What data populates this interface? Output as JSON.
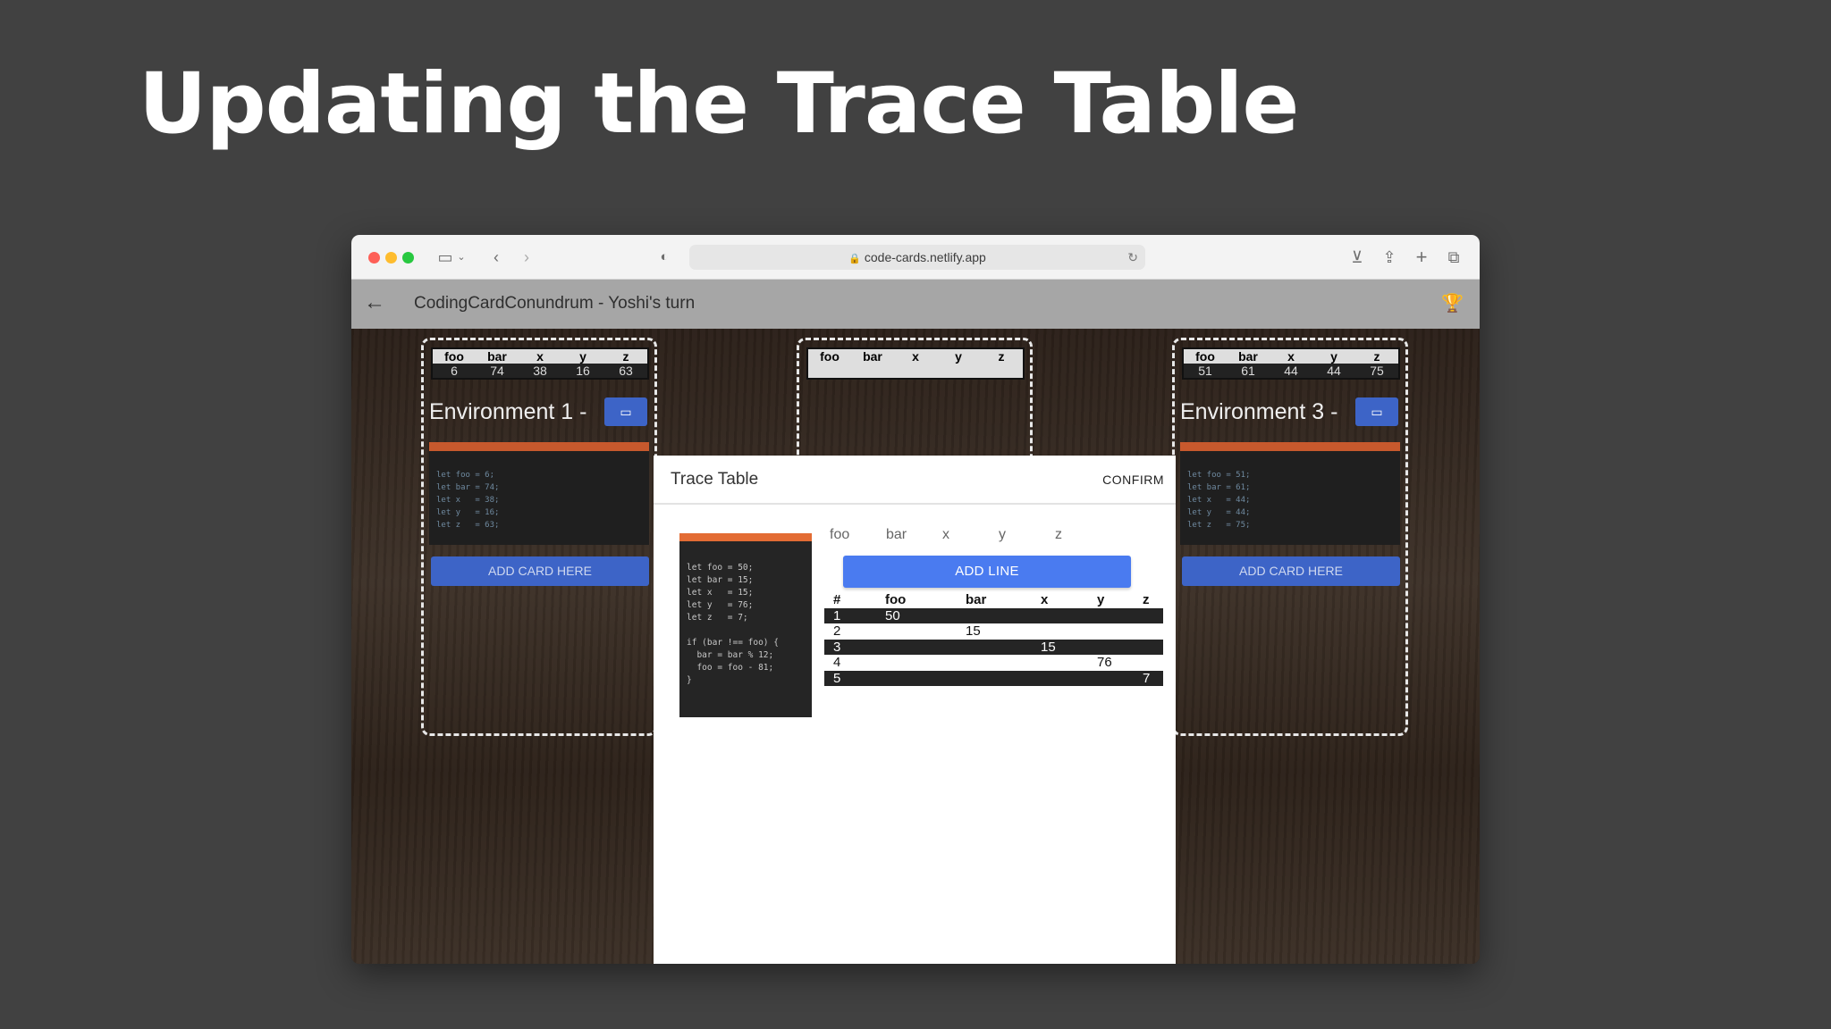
{
  "slide": {
    "title": "Updating the Trace Table"
  },
  "browser": {
    "url": "code-cards.netlify.app"
  },
  "app": {
    "title": "CodingCardConundrum - Yoshi's turn"
  },
  "mini_headers": [
    "foo",
    "bar",
    "x",
    "y",
    "z"
  ],
  "environments": [
    {
      "title": "Environment 1 -",
      "values": [
        "6",
        "74",
        "38",
        "16",
        "63"
      ],
      "code": [
        "let foo = 6;",
        "let bar = 74;",
        "let x   = 38;",
        "let y   = 16;",
        "let z   = 63;"
      ],
      "add_card": "ADD CARD HERE"
    },
    {
      "title": "",
      "values": [],
      "code": [],
      "add_card": ""
    },
    {
      "title": "Environment 3 -",
      "values": [
        "51",
        "61",
        "44",
        "44",
        "75"
      ],
      "code": [
        "let foo = 51;",
        "let bar = 61;",
        "let x   = 44;",
        "let y   = 44;",
        "let z   = 75;"
      ],
      "add_card": "ADD CARD HERE"
    }
  ],
  "modal": {
    "title": "Trace Table",
    "confirm": "CONFIRM",
    "code": [
      "let foo = 50;",
      "let bar = 15;",
      "let x   = 15;",
      "let y   = 76;",
      "let z   = 7;",
      "",
      "if (bar !== foo) {",
      "  bar = bar % 12;",
      "  foo = foo - 81;",
      "}"
    ],
    "variables": [
      "foo",
      "bar",
      "x",
      "y",
      "z"
    ],
    "add_line": "ADD LINE",
    "trace_headers": [
      "#",
      "foo",
      "bar",
      "x",
      "y",
      "z"
    ],
    "trace_rows": [
      [
        "1",
        "50",
        "",
        "",
        "",
        ""
      ],
      [
        "2",
        "",
        "15",
        "",
        "",
        ""
      ],
      [
        "3",
        "",
        "",
        "15",
        "",
        ""
      ],
      [
        "4",
        "",
        "",
        "",
        "76",
        ""
      ],
      [
        "5",
        "",
        "",
        "",
        "",
        "7"
      ]
    ]
  }
}
